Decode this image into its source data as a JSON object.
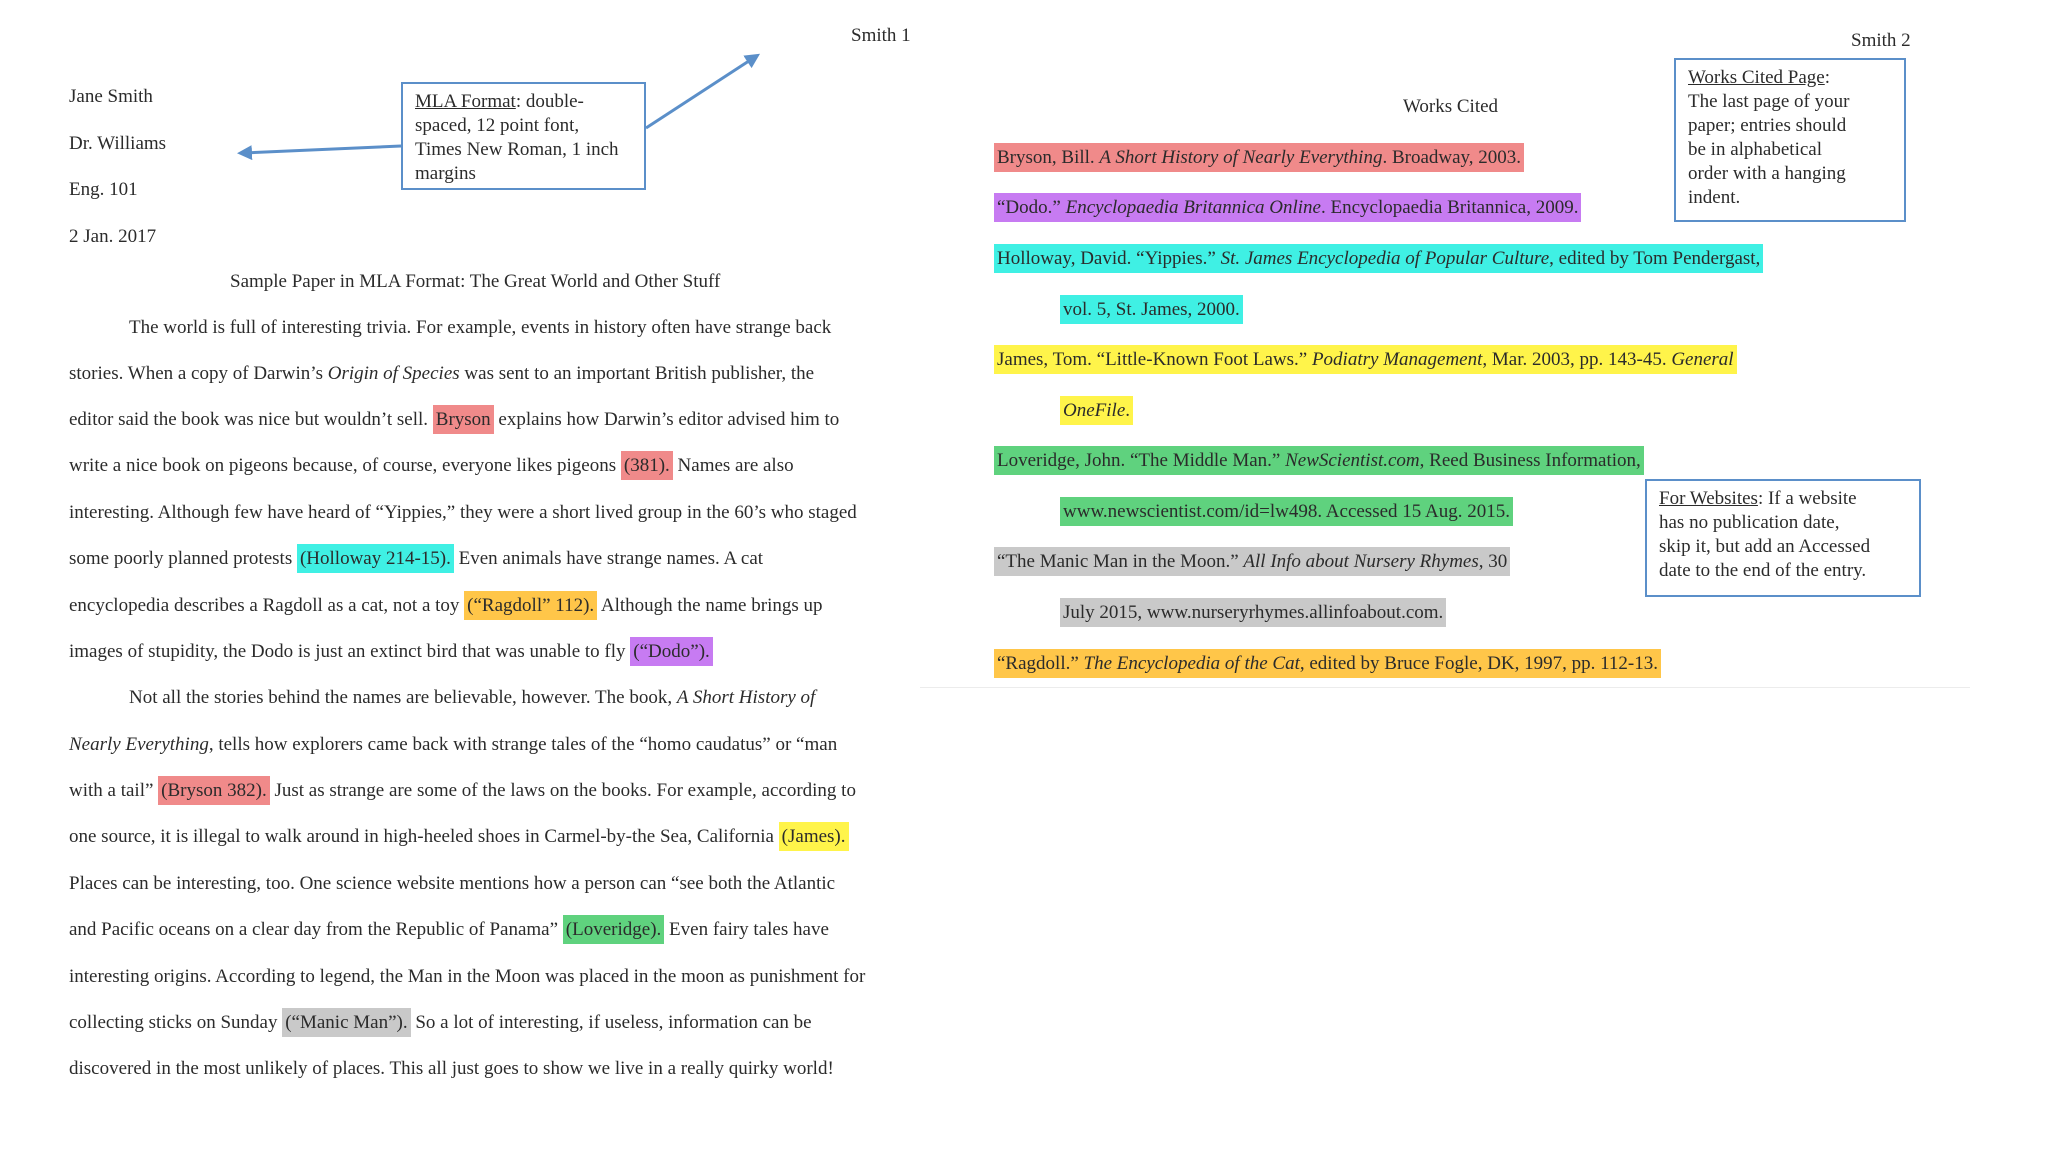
{
  "colors": {
    "red": "#f08a8a",
    "purple": "#c77bf2",
    "cyan": "#3ff0e4",
    "yellow": "#fff44a",
    "green": "#5fd27e",
    "gray": "#c9c9c9",
    "orange": "#ffc649",
    "arrow": "#5b8fc9",
    "box_border": "#5b8fc9"
  },
  "page1": {
    "header": "Smith 1",
    "heading_lines": [
      "Jane Smith",
      "Dr. Williams",
      "Eng. 101",
      "2 Jan. 2017"
    ],
    "title": "Sample Paper in MLA Format: The Great World and Other Stuff",
    "callout": {
      "label": "MLA Format",
      "lines": [
        ": double-",
        "spaced, 12 point font,",
        "Times New Roman, 1 inch",
        "margins"
      ]
    },
    "body": [
      [
        "    The world is full of interesting trivia. For example, events in history often have strange back"
      ],
      [
        "stories.  When a copy of Darwin’s ",
        "Origin of Species",
        " was sent to an important British publisher, the"
      ],
      [
        "editor said the book was nice but wouldn’t sell. ",
        "Bryson",
        " explains how Darwin’s editor advised him to"
      ],
      [
        "write a nice book on pigeons because, of course, everyone likes pigeons ",
        "(381).",
        "  Names are also"
      ],
      [
        "interesting. Although few have heard of “Yippies,” they were a short lived group in the 60’s who staged"
      ],
      [
        "some poorly planned protests ",
        "(Holloway 214-15).",
        "  Even animals have strange names. A cat"
      ],
      [
        "encyclopedia describes a Ragdoll as a cat, not a toy ",
        "(“Ragdoll” 112).",
        "  Although the name brings up"
      ],
      [
        "images of stupidity, the Dodo is just an extinct bird that was unable to fly ",
        "(“Dodo”)."
      ],
      [
        "    Not all the stories behind the names are believable, however.  The book, ",
        "A Short History of"
      ],
      [
        "Nearly Everything",
        ", tells how explorers came back with strange tales of the “homo caudatus” or “man"
      ],
      [
        "with a tail” ",
        "(Bryson 382).",
        "  Just as strange are some of the laws on the books. For example, according to"
      ],
      [
        "one source, it is illegal to walk around in high-heeled shoes in Carmel-by-the Sea, California ",
        "(James)."
      ],
      [
        "Places can be interesting, too. One science website mentions how a person can “see both the Atlantic"
      ],
      [
        "and Pacific oceans on a clear day from the Republic of Panama” ",
        "(Loveridge).",
        "  Even fairy tales have"
      ],
      [
        "interesting origins. According to legend, the Man in the Moon was placed in the moon as punishment for"
      ],
      [
        "collecting sticks on Sunday ",
        "(“Manic Man”).",
        " So a lot of interesting, if useless, information can be"
      ],
      [
        "discovered in the most unlikely of places. This all just goes to show we live in a really quirky world!"
      ]
    ]
  },
  "page2": {
    "header": "Smith 2",
    "title": "Works Cited",
    "callout_works": {
      "label": "Works Cited Page",
      "lines": [
        ":",
        "The last page of your",
        "paper; entries should",
        "be in alphabetical",
        "order with a hanging",
        "indent."
      ]
    },
    "callout_web": {
      "label": "For Websites",
      "lines": [
        ": If a website",
        "has no publication date,",
        "skip it, but add an Accessed",
        "date to the end of the entry."
      ]
    },
    "entries": [
      [
        "Bryson, Bill. ",
        "A Short History of Nearly Everything",
        ". Broadway, 2003."
      ],
      [
        "“Dodo.” ",
        "Encyclopaedia Britannica Online",
        ". Encyclopaedia Britannica, 2009."
      ],
      [
        "Holloway, David. “Yippies.” ",
        "St. James Encyclopedia of Popular Culture",
        ", edited by Tom Pendergast,"
      ],
      [
        "vol. 5, St. James, 2000."
      ],
      [
        "James, Tom. “Little-Known Foot Laws.”  ",
        "Podiatry Management",
        ", Mar. 2003, pp. 143-45. ",
        "General"
      ],
      [
        "OneFile",
        "."
      ],
      [
        "Loveridge, John. “The Middle Man.” ",
        "NewScientist.com",
        ", Reed Business Information,"
      ],
      [
        "www.newscientist.com/id=lw498. Accessed 15 Aug. 2015."
      ],
      [
        "“The Manic Man in the Moon.” ",
        "All Info about Nursery Rhymes",
        ", 30"
      ],
      [
        "July 2015, www.nurseryrhymes.allinfoabout.com."
      ],
      [
        "“Ragdoll.”  ",
        "The Encyclopedia of the Cat",
        ", edited by Bruce Fogle, DK, 1997, pp. 112-13."
      ]
    ]
  }
}
